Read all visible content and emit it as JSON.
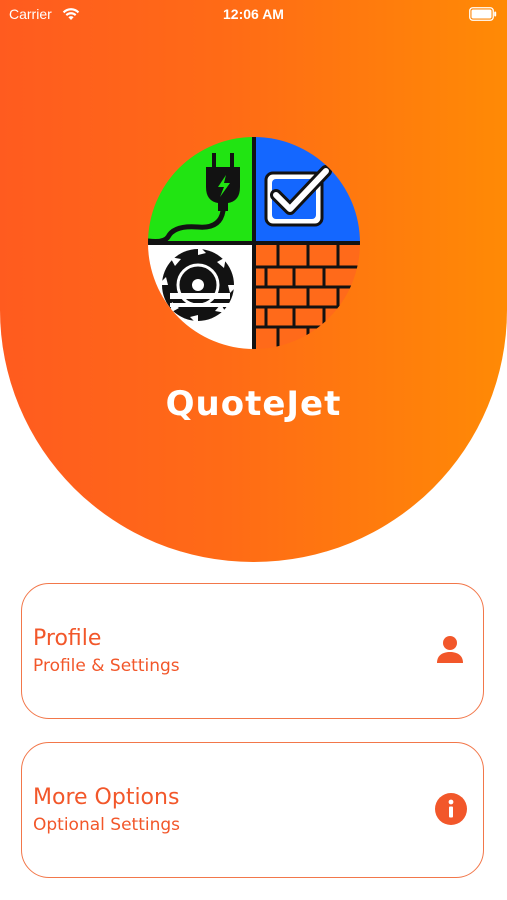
{
  "status_bar": {
    "carrier": "Carrier",
    "time": "12:06 AM"
  },
  "app": {
    "title": "QuoteJet"
  },
  "menu": {
    "items": [
      {
        "title": "Profile",
        "subtitle": "Profile & Settings",
        "icon": "person-icon"
      },
      {
        "title": "More Options",
        "subtitle": "Optional Settings",
        "icon": "info-icon"
      }
    ]
  },
  "colors": {
    "gradient_start": "#ff5b1f",
    "gradient_end": "#ff8a05",
    "accent": "#f2572a",
    "card_border": "#f2774a"
  }
}
